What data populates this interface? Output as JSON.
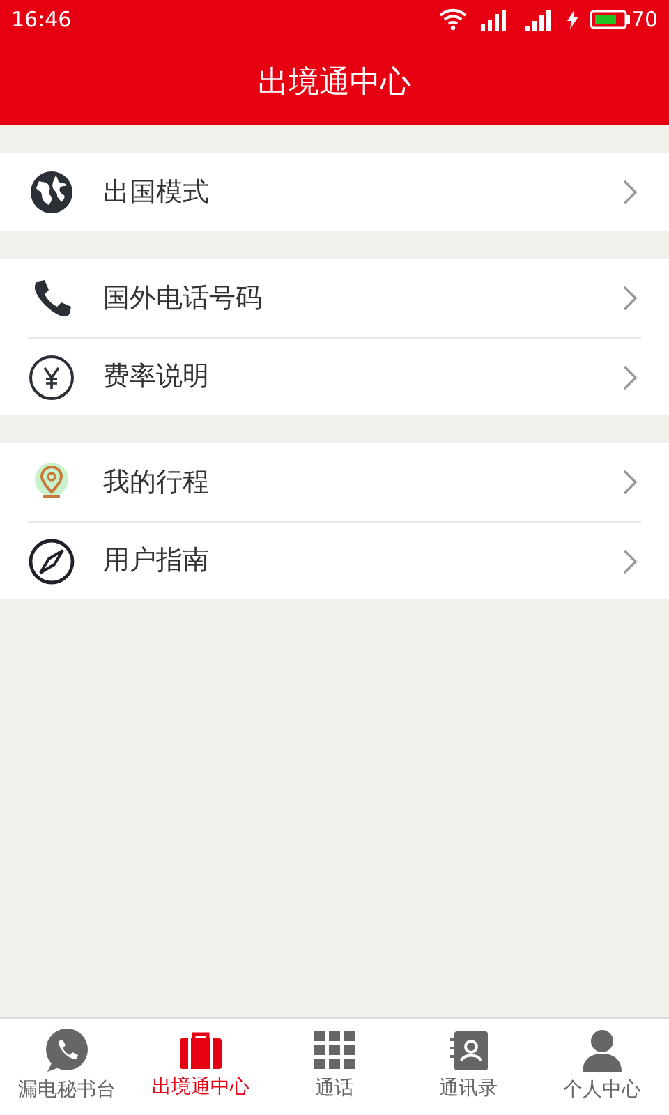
{
  "status_bar": {
    "time": "16:46",
    "battery": "70"
  },
  "header": {
    "title": "出境通中心"
  },
  "groups": [
    {
      "items": [
        {
          "kind": "globe",
          "label": "出国模式"
        }
      ]
    },
    {
      "items": [
        {
          "kind": "phone",
          "label": "国外电话号码"
        },
        {
          "kind": "yen",
          "label": "费率说明"
        }
      ]
    },
    {
      "items": [
        {
          "kind": "pin",
          "label": "我的行程"
        },
        {
          "kind": "compass",
          "label": "用户指南"
        }
      ]
    }
  ],
  "tab_bar": [
    {
      "kind": "chat",
      "label": "漏电秘书台",
      "selected": false
    },
    {
      "kind": "suitcase",
      "label": "出境通中心",
      "selected": true
    },
    {
      "kind": "grid",
      "label": "通话",
      "selected": false
    },
    {
      "kind": "contacts",
      "label": "通讯录",
      "selected": false
    },
    {
      "kind": "person",
      "label": "个人中心",
      "selected": false
    }
  ]
}
